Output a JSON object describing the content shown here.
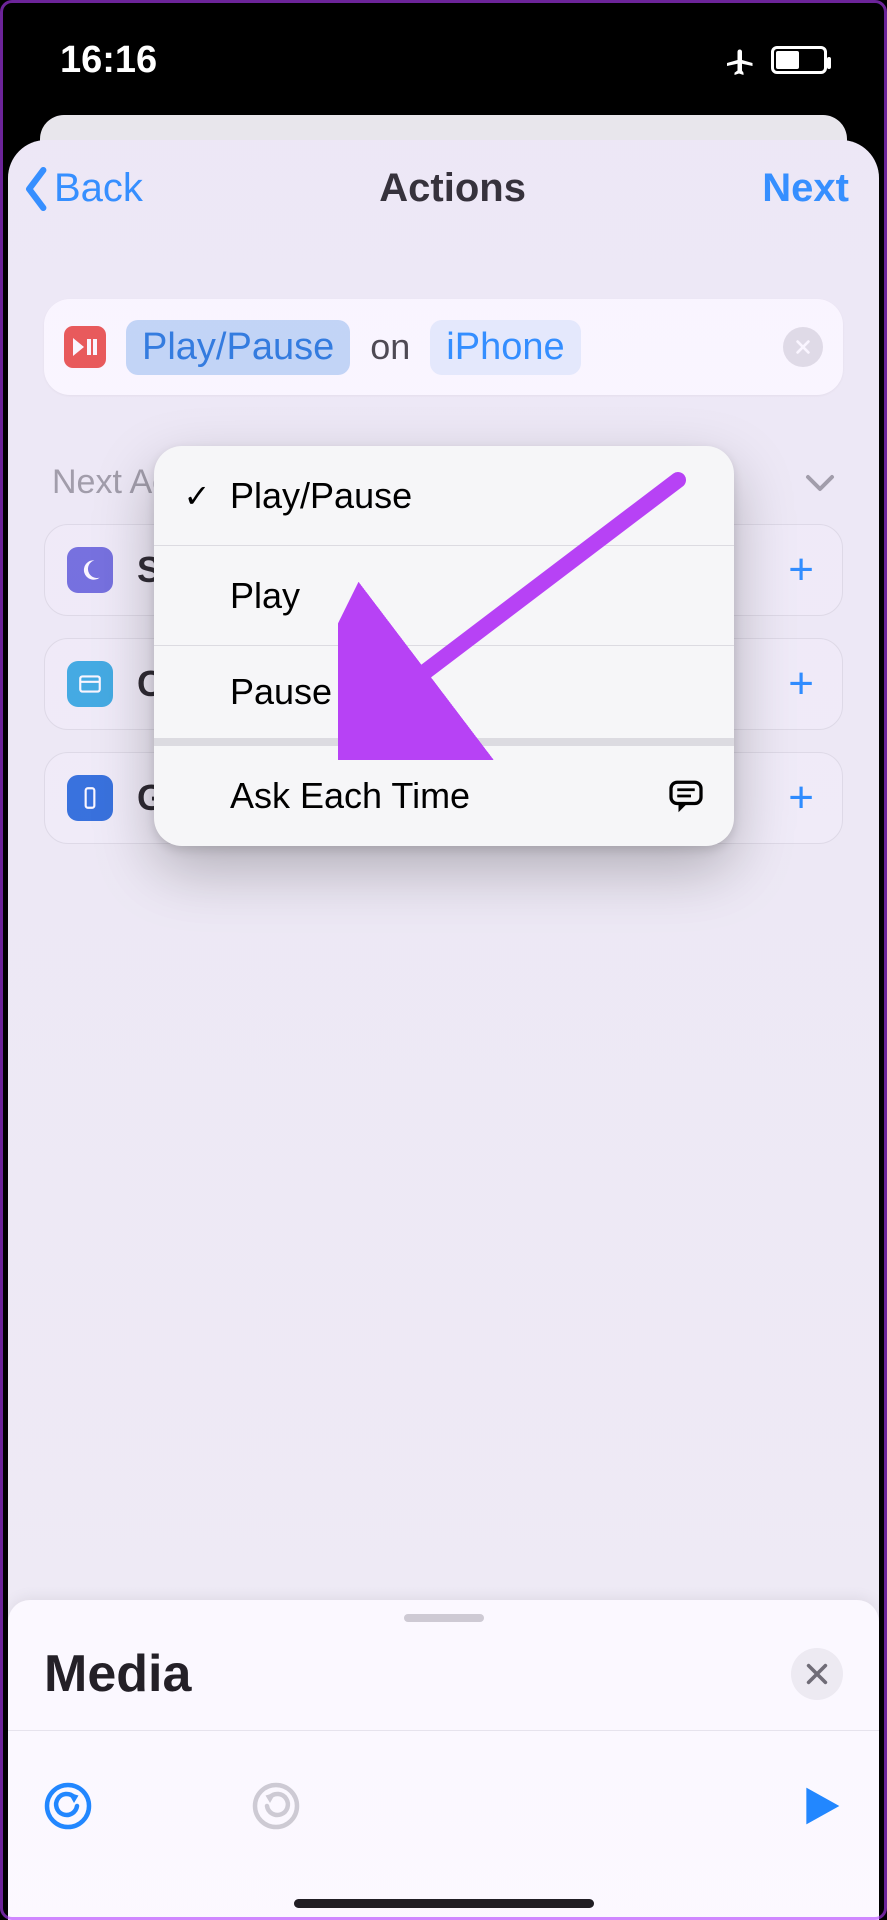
{
  "status": {
    "time": "16:16"
  },
  "nav": {
    "back": "Back",
    "title": "Actions",
    "next": "Next"
  },
  "action_pill": {
    "icon": "play-pause-icon",
    "token_action": "Play/Pause",
    "middle": "on",
    "token_device": "iPhone"
  },
  "popup": {
    "items": [
      {
        "label": "Play/Pause",
        "checked": true
      },
      {
        "label": "Play",
        "checked": false
      },
      {
        "label": "Pause",
        "checked": false
      }
    ],
    "ask_each_time": "Ask Each Time"
  },
  "suggestions": {
    "header": "Next Action Suggestions",
    "items": [
      {
        "label": "Set Focus",
        "icon": "moon"
      },
      {
        "label": "Choose from Menu",
        "icon": "card"
      },
      {
        "label": "Get Device Details",
        "icon": "phone"
      }
    ]
  },
  "tray": {
    "title": "Media"
  }
}
